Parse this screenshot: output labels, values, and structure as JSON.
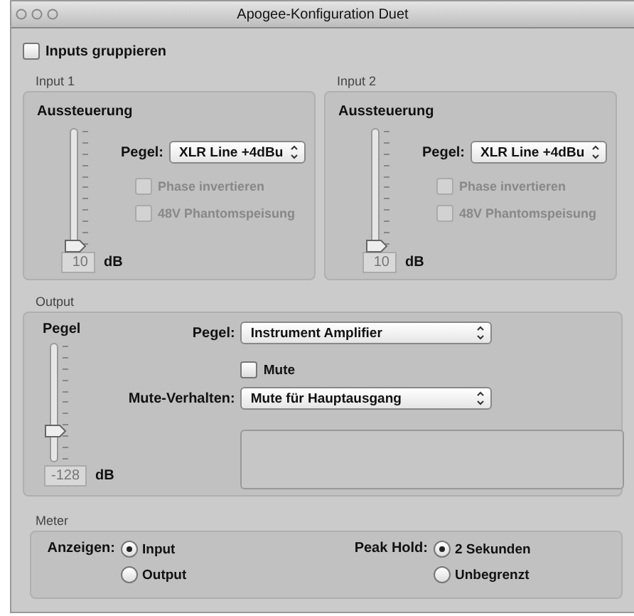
{
  "window": {
    "title": "Apogee-Konfiguration Duet"
  },
  "group_inputs": {
    "label": "Inputs gruppieren",
    "checked": false
  },
  "inputs": [
    {
      "title": "Input 1",
      "gain_label": "Aussteuerung",
      "level": 0,
      "value": "10",
      "unit": "dB",
      "pegel_label": "Pegel:",
      "pegel": "XLR Line +4dBu",
      "options": [
        {
          "label": "Phase invertieren",
          "checked": false,
          "disabled": true
        },
        {
          "label": "48V Phantomspeisung",
          "checked": false,
          "disabled": true
        }
      ]
    },
    {
      "title": "Input 2",
      "gain_label": "Aussteuerung",
      "level": 0,
      "value": "10",
      "unit": "dB",
      "pegel_label": "Pegel:",
      "pegel": "XLR Line +4dBu",
      "options": [
        {
          "label": "Phase invertieren",
          "checked": false,
          "disabled": true
        },
        {
          "label": "48V Phantomspeisung",
          "checked": false,
          "disabled": true
        }
      ]
    }
  ],
  "output": {
    "title": "Output",
    "slider_label": "Pegel",
    "level": 0.27,
    "value": "-128",
    "unit": "dB",
    "pegel_label": "Pegel:",
    "pegel": "Instrument Amplifier",
    "mute": {
      "label": "Mute",
      "checked": false
    },
    "mute_behavior_label": "Mute-Verhalten:",
    "mute_behavior": "Mute für Hauptausgang"
  },
  "meter": {
    "title": "Meter",
    "groups": [
      {
        "label": "Anzeigen:",
        "options": [
          {
            "label": "Input",
            "selected": true
          },
          {
            "label": "Output",
            "selected": false
          }
        ]
      },
      {
        "label": "Peak Hold:",
        "options": [
          {
            "label": "2 Sekunden",
            "selected": true
          },
          {
            "label": "Unbegrenzt",
            "selected": false
          }
        ]
      }
    ]
  }
}
